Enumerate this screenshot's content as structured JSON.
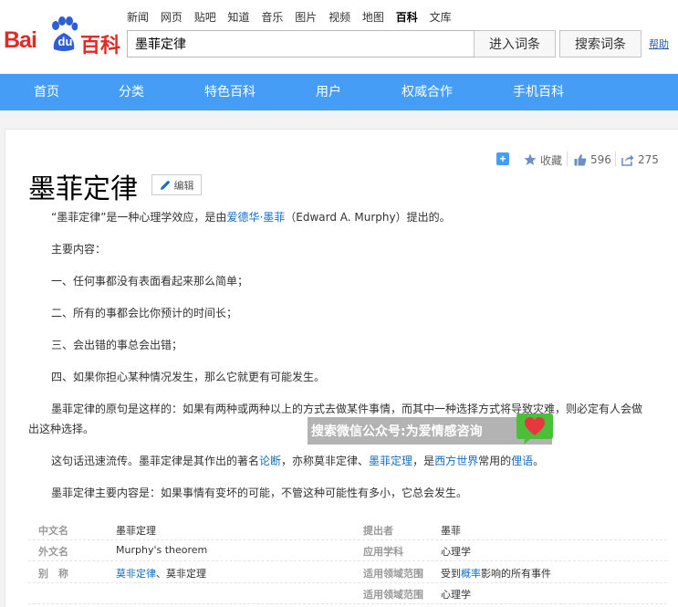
{
  "logo": {
    "bai": "Bai",
    "du": "du",
    "baike": "百科"
  },
  "topnav": [
    "新闻",
    "网页",
    "贴吧",
    "知道",
    "音乐",
    "图片",
    "视频",
    "地图",
    "百科",
    "文库"
  ],
  "topnav_active": "百科",
  "search": {
    "value": "墨菲定律",
    "enter_label": "进入词条",
    "search_label": "搜索词条",
    "help": "帮助"
  },
  "mainnav": [
    "首页",
    "分类",
    "特色百科",
    "用户",
    "权威合作",
    "手机百科"
  ],
  "toolbar": {
    "collect": "收藏",
    "likes": "596",
    "shares": "275"
  },
  "article": {
    "title": "墨菲定律",
    "edit": "编辑",
    "p1_pre": "“墨菲定律”是一种心理学效应，是由",
    "p1_link": "爱德华·墨菲",
    "p1_post": "（Edward A. Murphy）提出的。",
    "p2": "主要内容：",
    "p3": "一、任何事都没有表面看起来那么简单；",
    "p4": "二、所有的事都会比你预计的时间长；",
    "p5": "三、会出错的事总会出错；",
    "p6": "四、如果你担心某种情况发生，那么它就更有可能发生。",
    "p7_line1": "墨菲定律的原句是这样的：如果有两种或两种以上的方式去做某件事情，而其中一种选择方式将导致灾难，则必定有人会做",
    "p7_line2": "出这种选择。",
    "p8_a": "这句话迅速流传。墨菲定律是其作出的著名",
    "p8_link1": "论断",
    "p8_b": "，亦称莫非定律、",
    "p8_link2": "墨菲定理",
    "p8_c": "，是",
    "p8_link3": "西方世界",
    "p8_d": "常用的",
    "p8_link4": "俚语",
    "p8_e": "。",
    "p9": "墨菲定律主要内容是：如果事情有变坏的可能，不管这种可能性有多小，它总会发生。"
  },
  "infobox": {
    "rows": [
      {
        "l1": "中文名",
        "v1": "墨菲定理",
        "l2": "提出者",
        "v2": "墨菲",
        "v2_link": true
      },
      {
        "l1": "外文名",
        "v1": "Murphy's theorem",
        "l2": "应用学科",
        "v2": "心理学",
        "v2_link": true
      },
      {
        "l1": "别　称",
        "v1_link": "莫非定律",
        "v1_rest": "、莫非定理",
        "l2": "适用领域范围",
        "v2_pre": "受到",
        "v2_link_text": "概率",
        "v2_post": "影响的所有事件"
      },
      {
        "l2": "适用领域范围",
        "v2": "心理学",
        "v2_link": true
      }
    ]
  },
  "watermark": {
    "text": "搜索微信公众号:为爱情感咨询"
  },
  "colors": {
    "brand_red": "#de2b26",
    "brand_blue": "#2e5ed6",
    "nav_blue": "#459df5",
    "link": "#136ec2",
    "toolbar_icon": "#6e8fc6"
  }
}
